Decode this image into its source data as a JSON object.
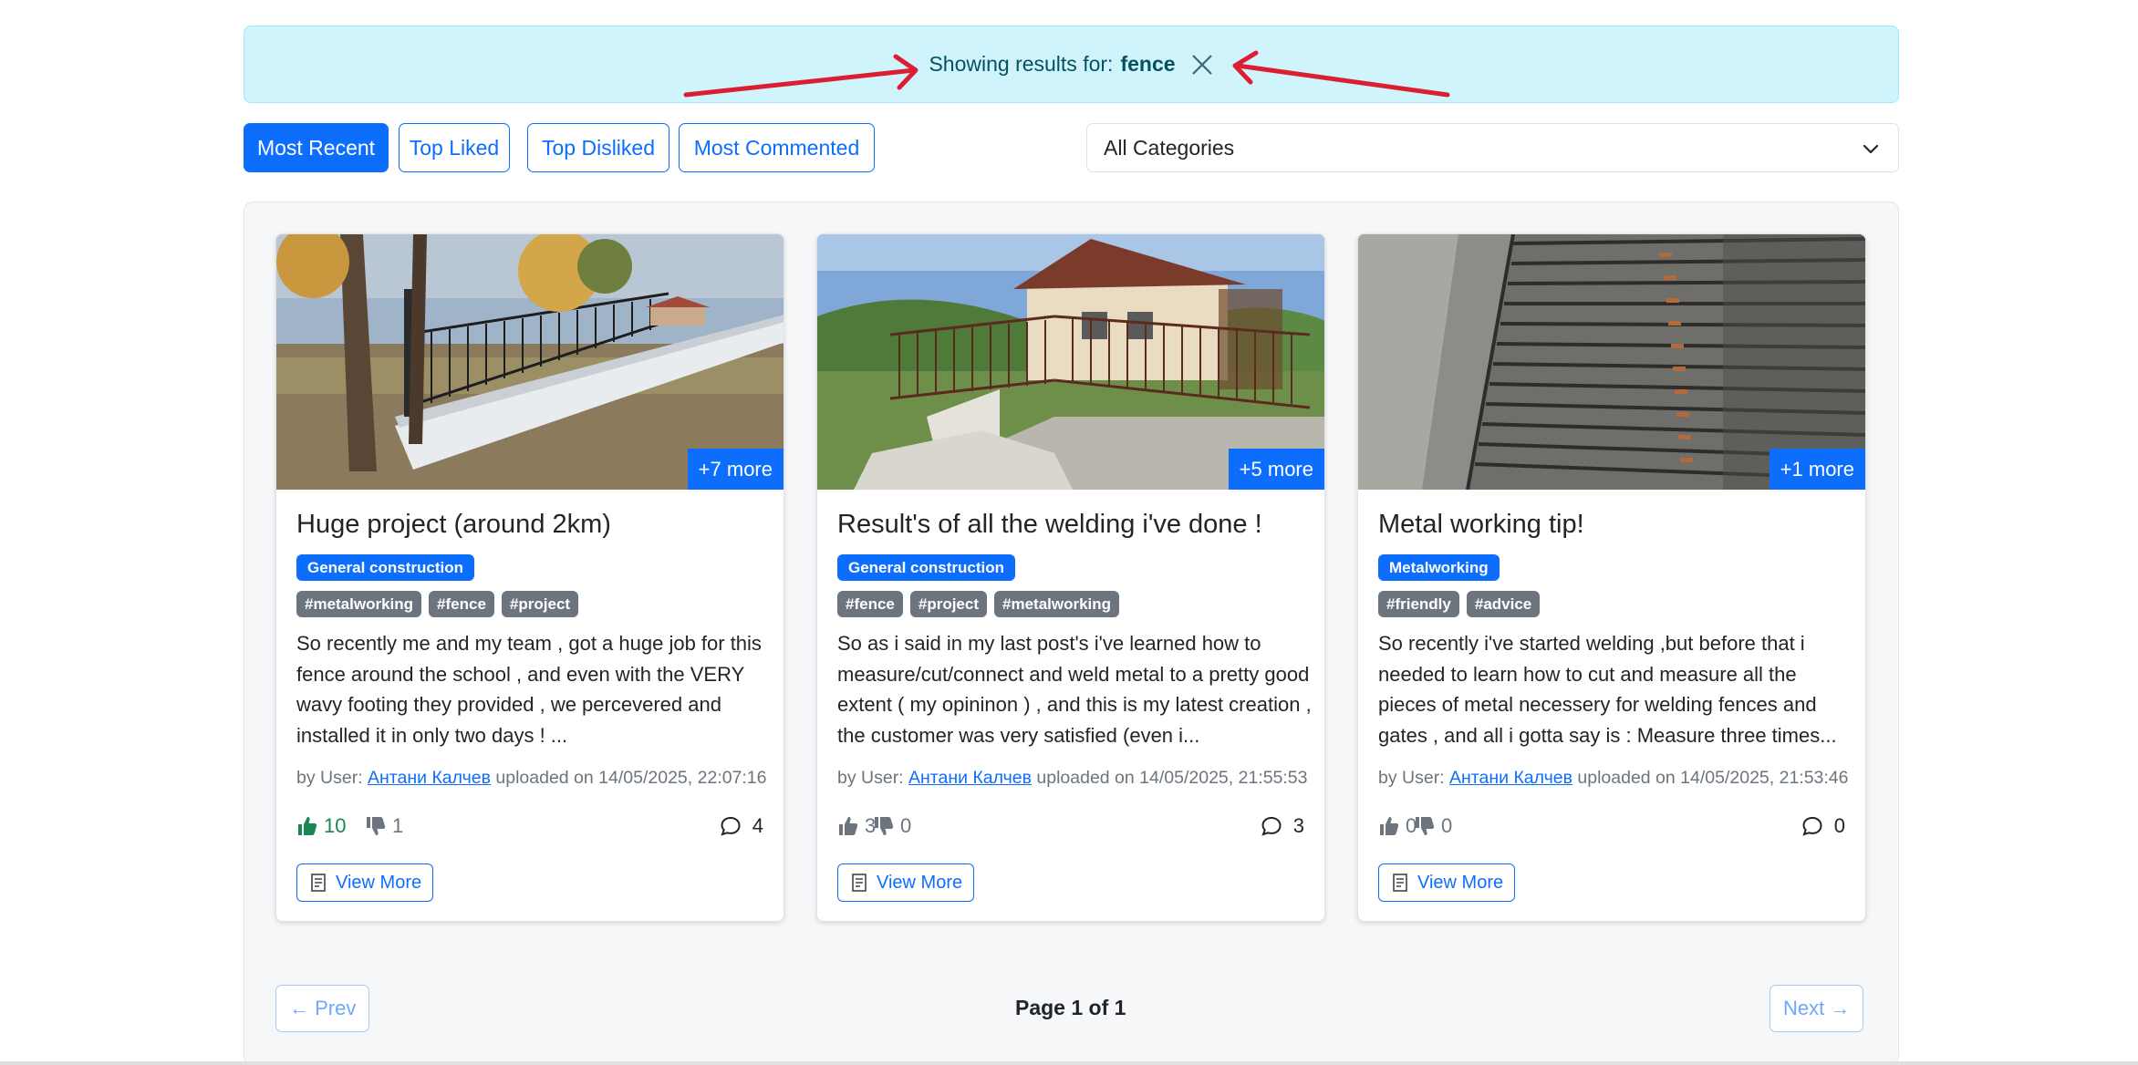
{
  "search_alert": {
    "prefix": "Showing results for:",
    "term": "fence",
    "close_icon": "close-icon"
  },
  "sort_buttons": [
    {
      "label": "Most Recent",
      "active": true
    },
    {
      "label": "Top Liked",
      "active": false
    },
    {
      "label": "Top Disliked",
      "active": false
    },
    {
      "label": "Most Commented",
      "active": false
    }
  ],
  "category_select": {
    "selected": "All Categories",
    "icon": "chevron-down-icon"
  },
  "posts": [
    {
      "image_badge": "+7 more",
      "title": "Huge project (around 2km)",
      "category": "General construction",
      "tags": [
        "#metalworking",
        "#fence",
        "#project"
      ],
      "description": "So recently me and my team , got a huge job for this fence around the school , and even with the VERY wavy footing they provided , we percevered and installed it in only two days ! ...",
      "byline_prefix": "by User:",
      "author": "Антани Калчев",
      "uploaded": "uploaded on 14/05/2025, 22:07:16",
      "likes": "10",
      "dislikes": "1",
      "comments": "4",
      "liked": true,
      "view_more": "View More"
    },
    {
      "image_badge": "+5 more",
      "title": "Result's of all the welding i've done !",
      "category": "General construction",
      "tags": [
        "#fence",
        "#project",
        "#metalworking"
      ],
      "description": "So as i said in my last post's i've learned how to measure/cut/connect and weld metal to a pretty good extent ( my opininon ) , and this is my latest creation , the customer was very satisfied (even i...",
      "byline_prefix": "by User:",
      "author": "Антани Калчев",
      "uploaded": "uploaded on 14/05/2025, 21:55:53",
      "likes": "3",
      "dislikes": "0",
      "comments": "3",
      "liked": false,
      "view_more": "View More"
    },
    {
      "image_badge": "+1 more",
      "title": "Metal working tip!",
      "category": "Metalworking",
      "tags": [
        "#friendly",
        "#advice"
      ],
      "description": "So recently i've started welding ,but before that i needed to learn how to cut and measure all the pieces of metal necessery for welding fences and gates , and all i gotta say is : Measure three times...",
      "byline_prefix": "by User:",
      "author": "Антани Калчев",
      "uploaded": "uploaded on 14/05/2025, 21:53:46",
      "likes": "0",
      "dislikes": "0",
      "comments": "0",
      "liked": false,
      "view_more": "View More"
    }
  ],
  "pagination": {
    "prev": "← Prev",
    "page_info": "Page 1 of 1",
    "next": "Next →"
  },
  "colors": {
    "primary": "#0d6efd",
    "alert_bg": "#cff4fc",
    "alert_text": "#055160",
    "tag_gray": "#6c757d",
    "like_green": "#198754",
    "annotation_red": "#dc1e32"
  }
}
